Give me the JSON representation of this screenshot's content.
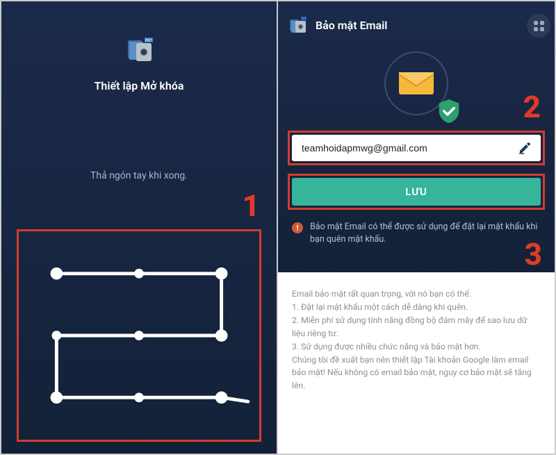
{
  "left": {
    "title": "Thiết lập Mở khóa",
    "hint": "Thả ngón tay khi xong.",
    "step_label": "1"
  },
  "right": {
    "header_title": "Bảo mật Email",
    "email_value": "teamhoidapmwg@gmail.com",
    "save_label": "LƯU",
    "info_text": "Bảo mật Email có thể được sử dụng để đặt lại mật khẩu khi bạn quên mật khẩu.",
    "step2_label": "2",
    "step3_label": "3",
    "body_intro": "Email bảo mật rất quan trọng, với nó bạn có thể:",
    "body_1": "1. Đặt lại mật khẩu một cách dễ dàng khi quên.",
    "body_2": "2. Miễn phí sử dụng tính năng đồng bộ đám mây để sao lưu dữ liệu riêng tư.",
    "body_3": "3. Sử dụng được nhiều chức năng và bảo mật hơn.",
    "body_outro": "Chúng tôi đề xuất bạn nên thiết lập Tài khoản Google làm email bảo mật! Nếu không có email bảo mật, nguy cơ bảo mật sẽ tăng lên."
  }
}
